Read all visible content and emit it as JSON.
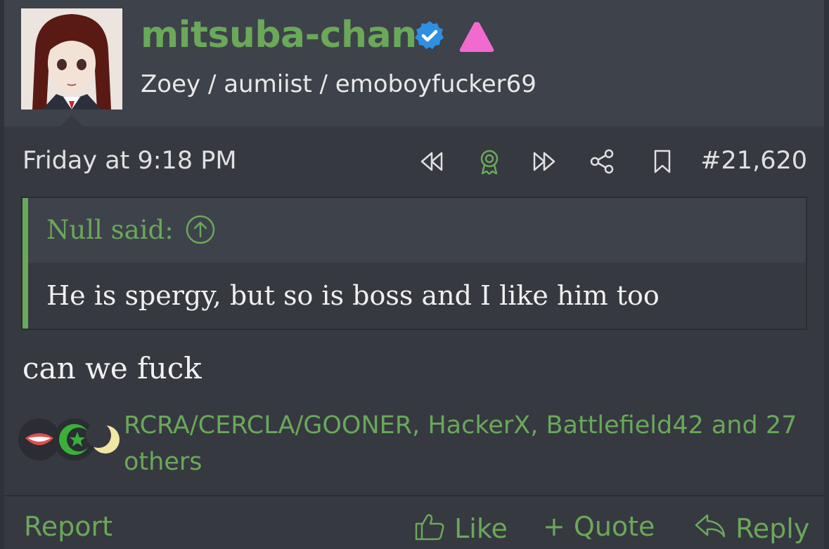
{
  "post": {
    "username": "mitsuba-chan",
    "user_title": "Zoey / aumiist / emoboyfucker69",
    "date": "Friday at 9:18 PM",
    "post_number": "#21,620",
    "quote": {
      "author": "Null said:",
      "text": "He is spergy, but so is boss and I like him too"
    },
    "message": "can we fuck",
    "reactions": {
      "summary": "RCRA/CERCLA/GOONER, HackerX, Battlefield42 and 27 others",
      "icons": [
        "lips-icon",
        "star-crescent-icon",
        "crescent-moon-icon"
      ]
    }
  },
  "actions": {
    "report": "Report",
    "like": "Like",
    "quote": "+ Quote",
    "reply": "Reply"
  },
  "colors": {
    "accent": "#6aa85a",
    "verified": "#2f8fe0",
    "triangle": "#f06ad0",
    "background": "#363940"
  }
}
